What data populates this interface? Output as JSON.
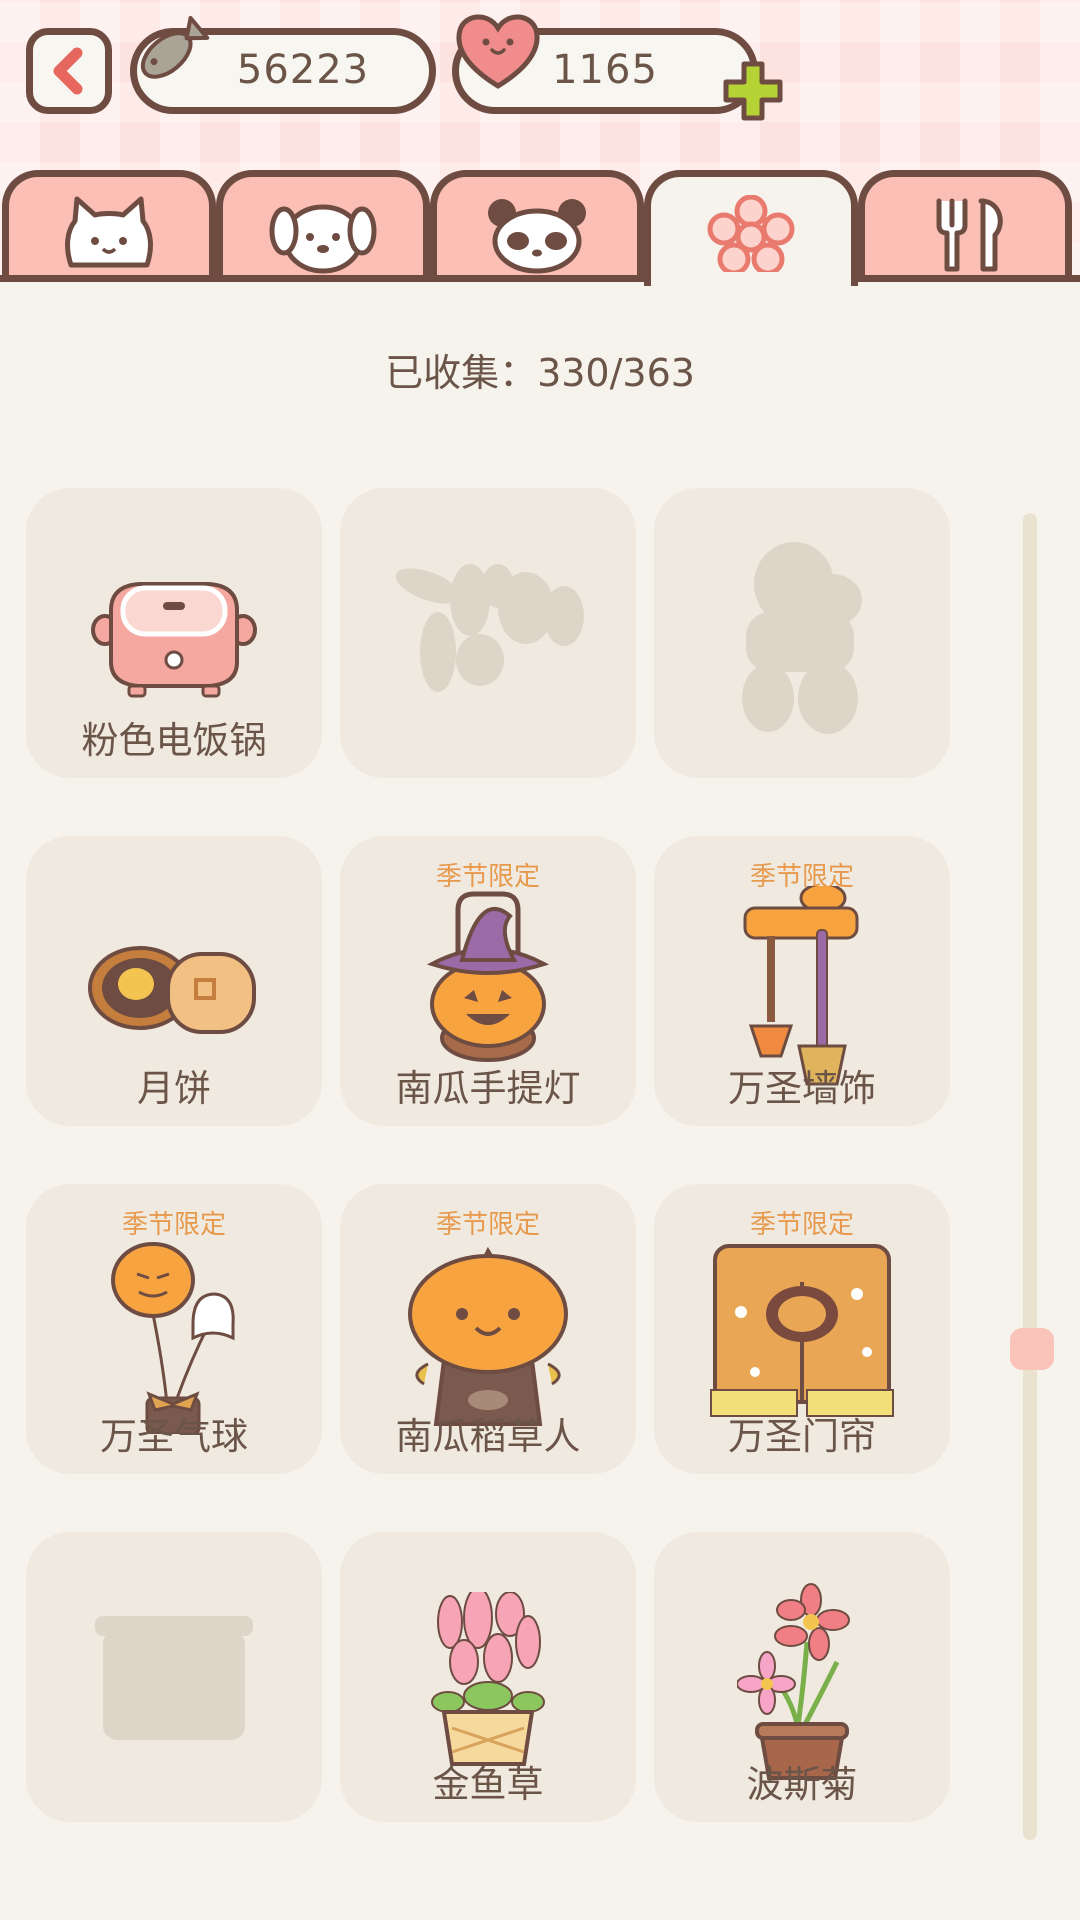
{
  "currency": {
    "fish_count": "56223",
    "heart_count": "1165"
  },
  "tabs": [
    {
      "icon": "cat-icon",
      "active": false
    },
    {
      "icon": "dog-icon",
      "active": false
    },
    {
      "icon": "panda-icon",
      "active": false
    },
    {
      "icon": "flower-icon",
      "active": true
    },
    {
      "icon": "fork-spoon-icon",
      "active": false
    }
  ],
  "collection": {
    "collected_text": "已收集：330/363",
    "seasonal_tag": "季节限定",
    "items": [
      {
        "label": "粉色电饭锅",
        "seasonal": false,
        "locked": false,
        "icon": "rice-cooker-icon"
      },
      {
        "label": "",
        "seasonal": false,
        "locked": true,
        "icon": "locked-silhouette-icon"
      },
      {
        "label": "",
        "seasonal": false,
        "locked": true,
        "icon": "locked-silhouette-icon"
      },
      {
        "label": "月饼",
        "seasonal": false,
        "locked": false,
        "icon": "mooncake-icon"
      },
      {
        "label": "南瓜手提灯",
        "seasonal": true,
        "locked": false,
        "icon": "pumpkin-lantern-icon"
      },
      {
        "label": "万圣墙饰",
        "seasonal": true,
        "locked": false,
        "icon": "halloween-wall-decor-icon"
      },
      {
        "label": "万圣气球",
        "seasonal": true,
        "locked": false,
        "icon": "halloween-balloon-icon"
      },
      {
        "label": "南瓜稻草人",
        "seasonal": true,
        "locked": false,
        "icon": "pumpkin-scarecrow-icon"
      },
      {
        "label": "万圣门帘",
        "seasonal": true,
        "locked": false,
        "icon": "halloween-curtain-icon"
      },
      {
        "label": "",
        "seasonal": false,
        "locked": true,
        "icon": "locked-silhouette-icon"
      },
      {
        "label": "金鱼草",
        "seasonal": false,
        "locked": false,
        "icon": "snapdragon-icon"
      },
      {
        "label": "波斯菊",
        "seasonal": false,
        "locked": false,
        "icon": "cosmos-flower-icon"
      }
    ]
  },
  "colors": {
    "accent_pink": "#fbbfb6",
    "outline_brown": "#6e4c42",
    "seasonal_orange": "#e79a4d",
    "card_bg": "#efe9df",
    "plus_green": "#b5d334"
  }
}
